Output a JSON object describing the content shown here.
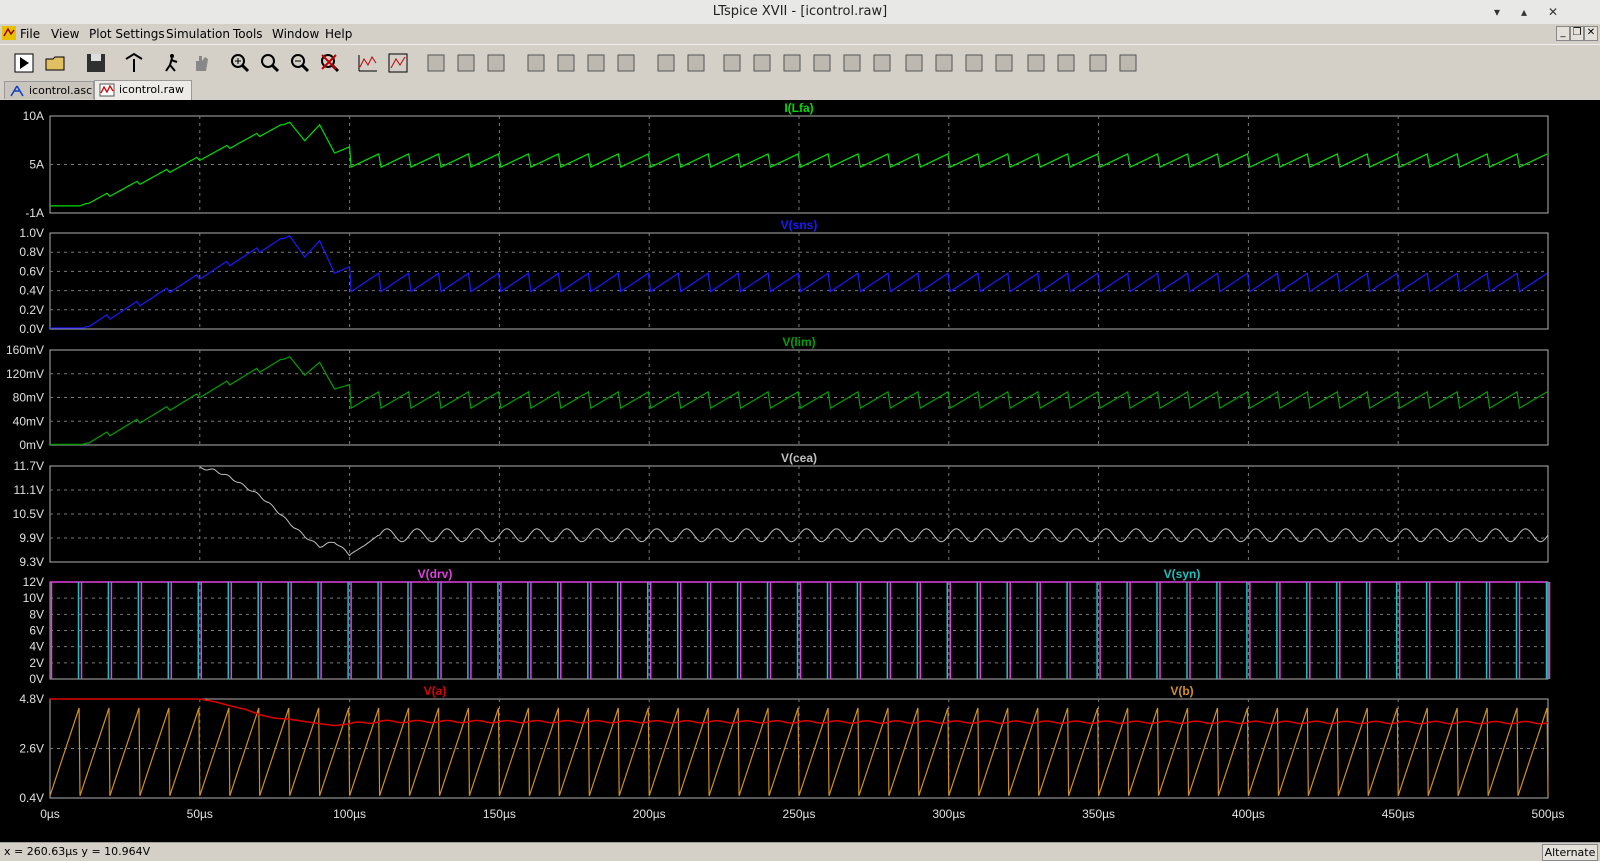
{
  "window": {
    "title": "LTspice XVII - [icontrol.raw]"
  },
  "menu": [
    "File",
    "View",
    "Plot Settings",
    "Simulation",
    "Tools",
    "Window",
    "Help"
  ],
  "tabs": [
    {
      "label": "icontrol.asc",
      "icon": "schematic-icon"
    },
    {
      "label": "icontrol.raw",
      "icon": "waveform-icon"
    }
  ],
  "toolbar": [
    "run-icon",
    "open-icon",
    "save-icon",
    "control-panel-icon",
    "halt-icon",
    "hand-icon",
    "zoom-in-icon",
    "zoom-area-icon",
    "zoom-out-icon",
    "zoom-cancel-icon",
    "autorange-icon",
    "fit-icon",
    "tile-horizontal-icon",
    "cascade-icon",
    "tile-vertical-icon",
    "cut-icon",
    "copy-icon",
    "paste-icon",
    "find-icon",
    "print-icon",
    "print-preview-icon",
    "wire-icon",
    "ground-icon",
    "label-icon",
    "resistor-icon",
    "capacitor-icon",
    "inductor-icon",
    "diode-icon",
    "component-icon",
    "rotate-icon",
    "mirror-icon",
    "undo-icon",
    "redo-icon",
    "text-icon",
    "spice-directive-icon"
  ],
  "status": {
    "coord": "x = 260.63µs    y = 10.964V",
    "mode": "Alternate"
  },
  "chart_data": {
    "type": "line",
    "x_axis": {
      "label": "",
      "range": [
        0,
        500
      ],
      "unit": "µs",
      "ticks": [
        "0µs",
        "50µs",
        "100µs",
        "150µs",
        "200µs",
        "250µs",
        "300µs",
        "350µs",
        "400µs",
        "450µs",
        "500µs"
      ]
    },
    "grid": true,
    "panes": [
      {
        "traces": [
          {
            "name": "I(Lfa)",
            "color": "#00dd00"
          }
        ],
        "yticks": [
          "10A",
          "5A",
          "-1A"
        ],
        "ylim": [
          -1,
          10
        ],
        "points": [
          [
            0,
            -0.2
          ],
          [
            10,
            -0.2
          ],
          [
            80,
            9.3
          ],
          [
            85,
            7.2
          ],
          [
            90,
            9.0
          ],
          [
            95,
            5.8
          ],
          [
            100,
            6.5
          ],
          [
            100.5,
            4.7
          ],
          [
            110,
            5.8
          ],
          [
            115,
            4.7
          ],
          [
            500,
            5.2
          ]
        ],
        "steady": {
          "from": 100,
          "period": 10,
          "low": 4.2,
          "high": 5.7
        }
      },
      {
        "traces": [
          {
            "name": "V(sns)",
            "color": "#1a1aff"
          }
        ],
        "yticks": [
          "1.0V",
          "0.8V",
          "0.6V",
          "0.4V",
          "0.2V",
          "0.0V"
        ],
        "ylim": [
          0,
          1.0
        ],
        "points": [
          [
            0,
            0.01
          ],
          [
            11,
            0.01
          ],
          [
            80,
            0.97
          ],
          [
            85,
            0.75
          ],
          [
            90,
            0.92
          ],
          [
            95,
            0.58
          ],
          [
            100,
            0.65
          ],
          [
            100.5,
            0.49
          ],
          [
            500,
            0.55
          ]
        ],
        "steady": {
          "from": 100,
          "period": 10,
          "low": 0.39,
          "high": 0.58
        }
      },
      {
        "traces": [
          {
            "name": "V(lim)",
            "color": "#00a000"
          }
        ],
        "yticks": [
          "160mV",
          "120mV",
          "80mV",
          "40mV",
          "0mV"
        ],
        "ylim": [
          0,
          170
        ],
        "points": [
          [
            0,
            1
          ],
          [
            11,
            1
          ],
          [
            80,
            158
          ],
          [
            85,
            125
          ],
          [
            90,
            148
          ],
          [
            95,
            100
          ],
          [
            100,
            108
          ],
          [
            100.5,
            80
          ],
          [
            500,
            90
          ]
        ],
        "steady": {
          "from": 100,
          "period": 10,
          "low": 66,
          "high": 95
        }
      },
      {
        "traces": [
          {
            "name": "V(cea)",
            "color": "#c0c0c0"
          }
        ],
        "yticks": [
          "11.7V",
          "11.1V",
          "10.5V",
          "9.9V",
          "9.3V"
        ],
        "ylim": [
          9.3,
          11.9
        ],
        "points": [
          [
            50,
            11.85
          ],
          [
            55,
            11.78
          ],
          [
            60,
            11.6
          ],
          [
            65,
            11.35
          ],
          [
            70,
            11.1
          ],
          [
            75,
            10.75
          ],
          [
            80,
            10.35
          ],
          [
            85,
            10.0
          ],
          [
            90,
            9.72
          ],
          [
            95,
            9.85
          ],
          [
            100,
            9.5
          ],
          [
            105,
            9.75
          ],
          [
            110,
            10.05
          ],
          [
            500,
            9.95
          ]
        ],
        "steady": {
          "from": 100,
          "period": 10,
          "low": 9.85,
          "high": 10.2
        }
      },
      {
        "traces": [
          {
            "name": "V(drv)",
            "color": "#e040e0"
          },
          {
            "name": "V(syn)",
            "color": "#20c0c0"
          }
        ],
        "yticks": [
          "12V",
          "10V",
          "8V",
          "6V",
          "4V",
          "2V",
          "0V"
        ],
        "ylim": [
          0,
          12
        ],
        "pulse": {
          "high": 12,
          "low": 0,
          "period": 10,
          "drv_width": 0.9,
          "syn_width": 0.5
        }
      },
      {
        "traces": [
          {
            "name": "V(a)",
            "color": "#e00000"
          },
          {
            "name": "V(b)",
            "color": "#d09020"
          }
        ],
        "yticks": [
          "4.8V",
          "2.6V",
          "0.4V"
        ],
        "ylim": [
          0.4,
          4.8
        ],
        "points": [
          [
            0,
            4.8
          ],
          [
            50,
            4.8
          ],
          [
            55,
            4.68
          ],
          [
            60,
            4.5
          ],
          [
            65,
            4.35
          ],
          [
            70,
            4.1
          ],
          [
            75,
            3.95
          ],
          [
            80,
            3.9
          ],
          [
            85,
            3.8
          ],
          [
            90,
            3.7
          ],
          [
            95,
            3.62
          ],
          [
            100,
            3.7
          ],
          [
            110,
            3.8
          ],
          [
            500,
            3.75
          ]
        ],
        "sawtooth": {
          "period": 10,
          "low": 0.5,
          "high": 4.4
        }
      }
    ]
  }
}
